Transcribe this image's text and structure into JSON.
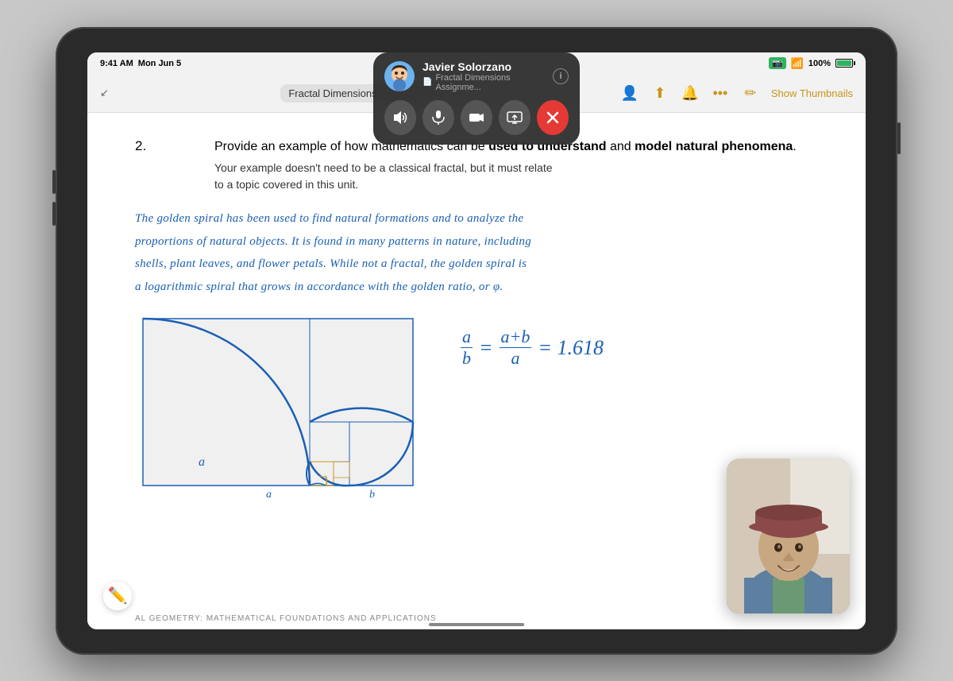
{
  "status_bar": {
    "time": "9:41 AM",
    "date": "Mon Jun 5",
    "battery": "100%"
  },
  "toolbar": {
    "doc_title": "Fractal Dimensions Assignment",
    "show_thumbnails_label": "Show Thumbnails"
  },
  "facetime": {
    "caller_name": "Javier Solorzano",
    "subtitle": "Fractal Dimensions Assignme...",
    "info_label": "i",
    "controls": {
      "speaker": "🔊",
      "mic": "🎤",
      "video": "📷",
      "screen": "⬜",
      "end": "✕"
    }
  },
  "document": {
    "question_number": "2.",
    "question_line1": "Provide an example of how mathematics can be ",
    "question_bold1": "used to understand",
    "question_and": " and ",
    "question_bold2": "model natural phenomena",
    "question_end": ".",
    "question_sub": "Your example doesn't need to be a classical fractal, but it must relate\nto a topic covered in this unit.",
    "handwritten_text": "The golden spiral has been used to find natural formations and to analyze the\nproportions of natural objects. It is found in many patterns in nature, including\nshells, plant leaves, and flower petals. While not a fractal, the golden spiral is\na logarithmic spiral that grows in accordance with the golden ratio, or φ.",
    "formula": "a/b = (a+b)/a = 1.618...",
    "spiral_label_a": "a",
    "spiral_label_b": "b",
    "spiral_label_a2": "a",
    "bottom_label": "AL GEOMETRY: MATHEMATICAL FOUNDATIONS AND APPLICATIONS"
  },
  "colors": {
    "blue_ink": "#1a5fb4",
    "toolbar_text": "#c8961c",
    "doc_bg": "#ffffff",
    "ipad_body": "#2a2a2a"
  }
}
